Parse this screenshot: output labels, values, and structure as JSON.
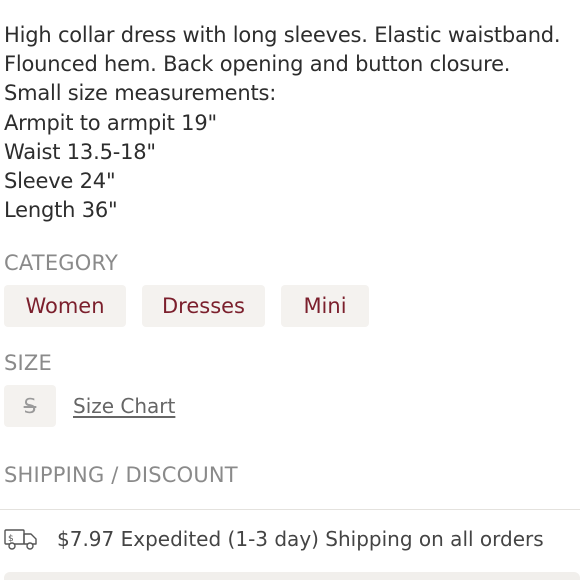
{
  "description": {
    "lines": [
      "High collar dress with long sleeves. Elastic waistband.",
      "Flounced hem. Back opening and button closure.",
      "Small size measurements:",
      "Armpit to armpit 19\"",
      "Waist 13.5-18\"",
      "Sleeve 24\"",
      "Length 36\""
    ]
  },
  "category": {
    "heading": "CATEGORY",
    "tags": [
      "Women",
      "Dresses",
      "Mini"
    ],
    "tag_color": "#7b1f2c"
  },
  "size": {
    "heading": "SIZE",
    "selected": "S",
    "size_chart_label": "Size Chart"
  },
  "shipping": {
    "heading": "SHIPPING / DISCOUNT",
    "icon": "truck-icon",
    "text": "$7.97 Expedited (1-3 day) Shipping on all orders"
  }
}
